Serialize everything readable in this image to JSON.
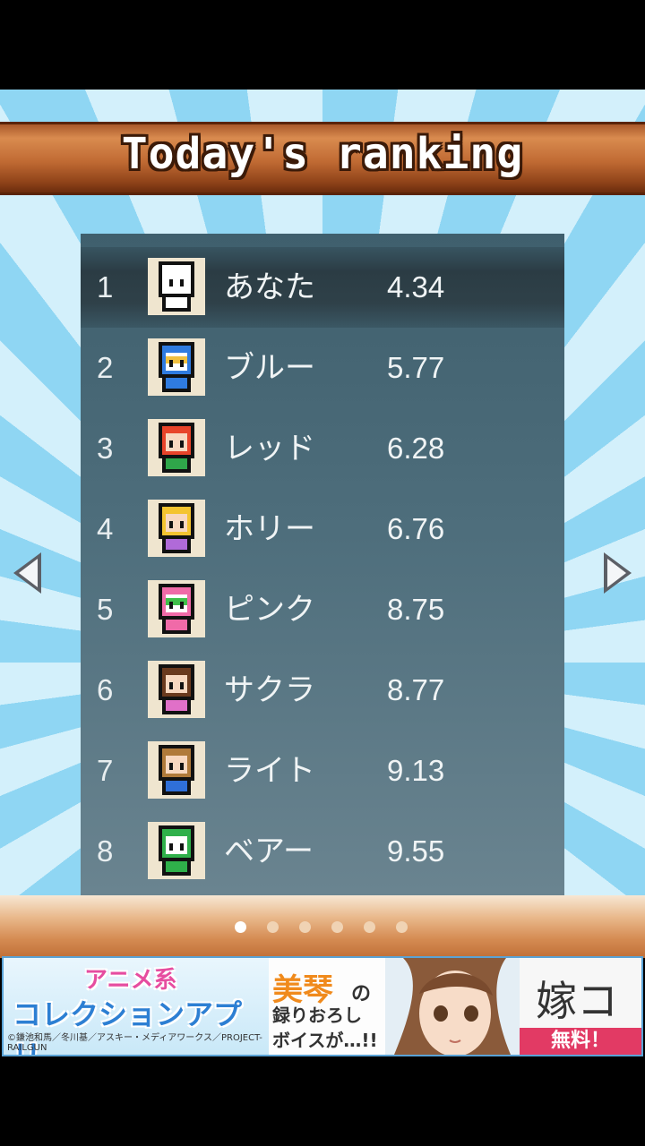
{
  "title": "Today's ranking",
  "rows": [
    {
      "rank": "1",
      "name": "あなた",
      "time": "4.34",
      "avatar": "white-character-icon",
      "selected": true
    },
    {
      "rank": "2",
      "name": "ブルー",
      "time": "5.77",
      "avatar": "blue-robot-icon"
    },
    {
      "rank": "3",
      "name": "レッド",
      "time": "6.28",
      "avatar": "red-hair-girl-icon"
    },
    {
      "rank": "4",
      "name": "ホリー",
      "time": "6.76",
      "avatar": "blonde-girl-icon"
    },
    {
      "rank": "5",
      "name": "ピンク",
      "time": "8.75",
      "avatar": "pink-robot-icon"
    },
    {
      "rank": "6",
      "name": "サクラ",
      "time": "8.77",
      "avatar": "brown-hair-girl-icon"
    },
    {
      "rank": "7",
      "name": "ライト",
      "time": "9.13",
      "avatar": "brown-hair-boy-icon"
    },
    {
      "rank": "8",
      "name": "ベアー",
      "time": "9.55",
      "avatar": "green-bear-icon"
    }
  ],
  "pager": {
    "count": 6,
    "active": 0
  },
  "ad": {
    "line1": "アニメ系",
    "line2": "コレクションアプリ",
    "copyright": "©鎌池和馬／冬川基／アスキー・メディアワークス／PROJECT-RAILGUN",
    "name": "美琴",
    "particle": "の",
    "line3": "録りおろし",
    "line4": "ボイスが…!!",
    "brand": "嫁コレ",
    "free": "無料！"
  },
  "colors": {
    "panel": "#4e6e7c",
    "wood": "#c06a33",
    "sky_light": "#d3f0fb",
    "sky_dark": "#8fd6f3"
  }
}
